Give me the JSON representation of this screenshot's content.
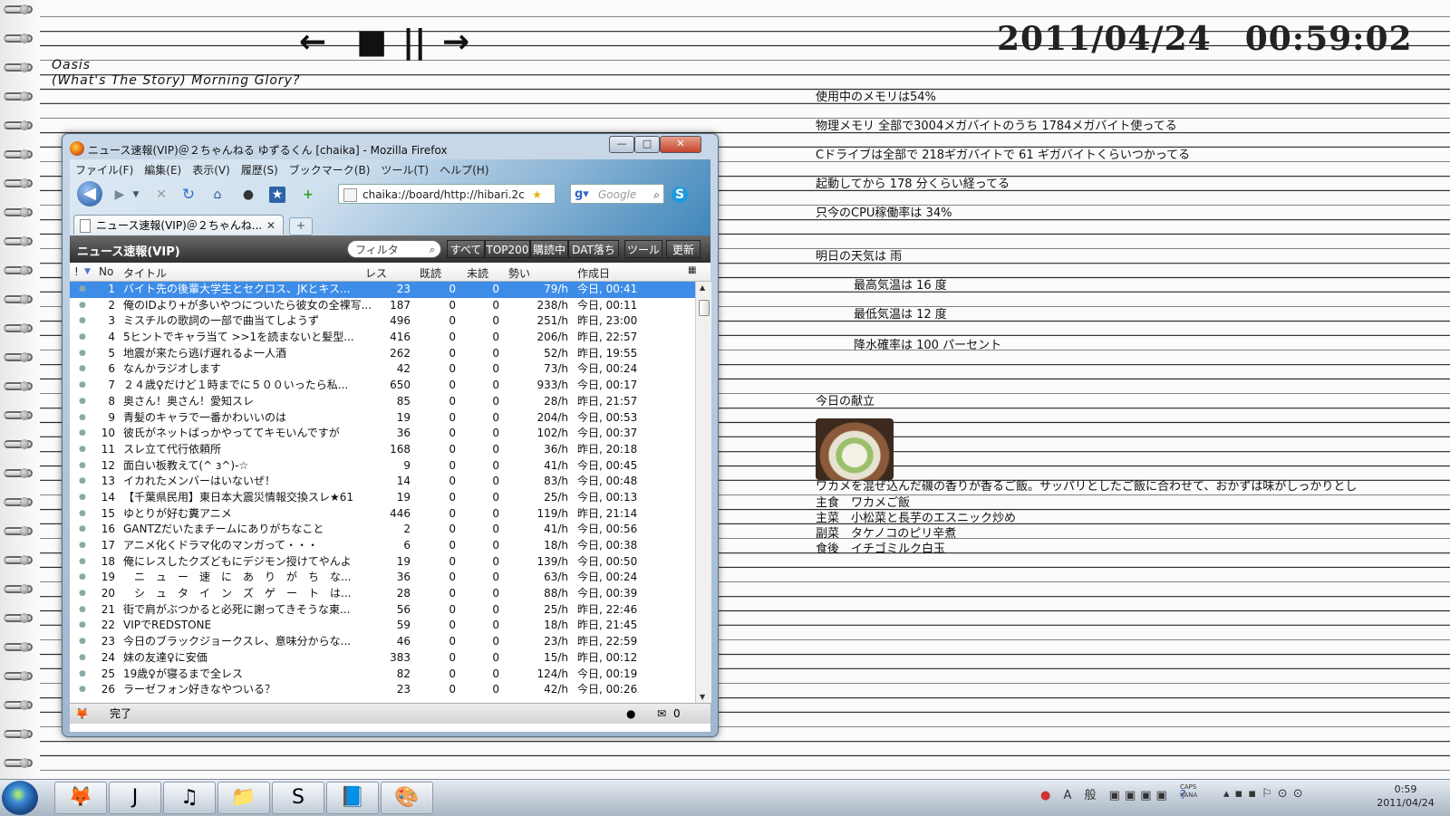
{
  "desktop": {
    "clock": "2011/04/24　00:59:02",
    "media_controls": {
      "prev": "←",
      "stop": "■",
      "pause": "||",
      "next": "→"
    },
    "now_playing": {
      "artist": "Oasis",
      "album": "(What's The Story) Morning Glory?"
    },
    "notes": [
      {
        "text": "使用中のメモリは54%"
      },
      {
        "text": "物理メモリ 全部で3004メガバイトのうち 1784メガバイト使ってる"
      },
      {
        "text": "Cドライブは全部で 218ギガバイトで 61 ギガバイトくらいつかってる"
      },
      {
        "text": "起動してから 178 分くらい経ってる"
      },
      {
        "text": "只今のCPU稼働率は 34%"
      },
      {
        "text": "明日の天気は 雨"
      },
      {
        "text": "最高気温は 16 度"
      },
      {
        "text": "最低気温は 12 度"
      },
      {
        "text": "降水確率は 100 パーセント"
      },
      {
        "text": "今日の献立"
      }
    ],
    "menu_description": "ワカメを混ぜ込んだ磯の香りが香るご飯。サッパリとしたご飯に合わせて、おかずは味がしっかりとし",
    "menu_items": [
      {
        "course": "主食",
        "dish": "ワカメご飯"
      },
      {
        "course": "主菜",
        "dish": "小松菜と長芋のエスニック炒め"
      },
      {
        "course": "副菜",
        "dish": "タケノコのピリ辛煮"
      },
      {
        "course": "食後",
        "dish": "イチゴミルク白玉"
      }
    ]
  },
  "window": {
    "title": "ニュース速報(VIP)＠２ちゃんねる ゆずるくん [chaika] - Mozilla Firefox",
    "buttons": {
      "minimize": "—",
      "maximize": "□",
      "close": "✕"
    },
    "menu": [
      "ファイル(F)",
      "編集(E)",
      "表示(V)",
      "履歴(S)",
      "ブックマーク(B)",
      "ツール(T)",
      "ヘルプ(H)"
    ],
    "url": "chaika://board/http://hibari.2c",
    "search_placeholder": "Google",
    "tab_label": "ニュース速報(VIP)＠２ちゃんね...",
    "board_name": "ニュース速報(VIP)",
    "filter_placeholder": "フィルタ",
    "board_buttons": [
      "すべて",
      "TOP200",
      "購読中",
      "DAT落ち",
      "ツール",
      "更新"
    ],
    "columns": {
      "flag": "!",
      "no": "No",
      "title": "タイトル",
      "res": "レス",
      "read": "既読",
      "unread": "未読",
      "momentum": "勢い",
      "date": "作成日"
    },
    "threads": [
      {
        "no": "1",
        "title": "バイト先の後輩大学生とセクロス、JKとキス...",
        "res": "23",
        "read": "0",
        "unread": "0",
        "momentum": "79/h",
        "date": "今日, 00:41"
      },
      {
        "no": "2",
        "title": "俺のIDより+が多いやつについたら彼女の全裸写...",
        "res": "187",
        "read": "0",
        "unread": "0",
        "momentum": "238/h",
        "date": "今日, 00:11"
      },
      {
        "no": "3",
        "title": "ミスチルの歌詞の一部で曲当てしようず",
        "res": "496",
        "read": "0",
        "unread": "0",
        "momentum": "251/h",
        "date": "昨日, 23:00"
      },
      {
        "no": "4",
        "title": "5ヒントでキャラ当て >>1を読まないと髪型...",
        "res": "416",
        "read": "0",
        "unread": "0",
        "momentum": "206/h",
        "date": "昨日, 22:57"
      },
      {
        "no": "5",
        "title": "地震が来たら逃げ遅れるよ一人酒",
        "res": "262",
        "read": "0",
        "unread": "0",
        "momentum": "52/h",
        "date": "昨日, 19:55"
      },
      {
        "no": "6",
        "title": "なんかラジオします",
        "res": "42",
        "read": "0",
        "unread": "0",
        "momentum": "73/h",
        "date": "今日, 00:24"
      },
      {
        "no": "7",
        "title": "２４歳♀だけど１時までに５００いったら私...",
        "res": "650",
        "read": "0",
        "unread": "0",
        "momentum": "933/h",
        "date": "今日, 00:17"
      },
      {
        "no": "8",
        "title": "奥さん！奥さん！愛知スレ",
        "res": "85",
        "read": "0",
        "unread": "0",
        "momentum": "28/h",
        "date": "昨日, 21:57"
      },
      {
        "no": "9",
        "title": "青髪のキャラで一番かわいいのは",
        "res": "19",
        "read": "0",
        "unread": "0",
        "momentum": "204/h",
        "date": "今日, 00:53"
      },
      {
        "no": "10",
        "title": "彼氏がネットばっかやっててキモいんですが",
        "res": "36",
        "read": "0",
        "unread": "0",
        "momentum": "102/h",
        "date": "今日, 00:37"
      },
      {
        "no": "11",
        "title": "スレ立て代行依頼所",
        "res": "168",
        "read": "0",
        "unread": "0",
        "momentum": "36/h",
        "date": "昨日, 20:18"
      },
      {
        "no": "12",
        "title": "面白い板教えて(^ з^)-☆",
        "res": "9",
        "read": "0",
        "unread": "0",
        "momentum": "41/h",
        "date": "今日, 00:45"
      },
      {
        "no": "13",
        "title": "イカれたメンバーはいないぜ！",
        "res": "14",
        "read": "0",
        "unread": "0",
        "momentum": "83/h",
        "date": "今日, 00:48"
      },
      {
        "no": "14",
        "title": "【千葉県民用】東日本大震災情報交換スレ★61",
        "res": "19",
        "read": "0",
        "unread": "0",
        "momentum": "25/h",
        "date": "今日, 00:13"
      },
      {
        "no": "15",
        "title": "ゆとりが好む糞アニメ",
        "res": "446",
        "read": "0",
        "unread": "0",
        "momentum": "119/h",
        "date": "昨日, 21:14"
      },
      {
        "no": "16",
        "title": "GANTZだいたまチームにありがちなこと",
        "res": "2",
        "read": "0",
        "unread": "0",
        "momentum": "41/h",
        "date": "今日, 00:56"
      },
      {
        "no": "17",
        "title": "アニメ化くドラマ化のマンガって・・・",
        "res": "6",
        "read": "0",
        "unread": "0",
        "momentum": "18/h",
        "date": "今日, 00:38"
      },
      {
        "no": "18",
        "title": "俺にレスしたクズどもにデジモン授けてやんよ",
        "res": "19",
        "read": "0",
        "unread": "0",
        "momentum": "139/h",
        "date": "今日, 00:50"
      },
      {
        "no": "19",
        "title": "　ニ　ュ　ー　速　に　あ　り　が　ち　な...",
        "res": "36",
        "read": "0",
        "unread": "0",
        "momentum": "63/h",
        "date": "今日, 00:24"
      },
      {
        "no": "20",
        "title": "　シ　ュ　タ　イ　ン　ズ　ゲ　ー　ト　は...",
        "res": "28",
        "read": "0",
        "unread": "0",
        "momentum": "88/h",
        "date": "今日, 00:39"
      },
      {
        "no": "21",
        "title": "街で肩がぶつかると必死に謝ってきそうな東...",
        "res": "56",
        "read": "0",
        "unread": "0",
        "momentum": "25/h",
        "date": "昨日, 22:46"
      },
      {
        "no": "22",
        "title": "VIPでREDSTONE",
        "res": "59",
        "read": "0",
        "unread": "0",
        "momentum": "18/h",
        "date": "昨日, 21:45"
      },
      {
        "no": "23",
        "title": "今日のブラックジョークスレ、意味分からな...",
        "res": "46",
        "read": "0",
        "unread": "0",
        "momentum": "23/h",
        "date": "昨日, 22:59"
      },
      {
        "no": "24",
        "title": "妹の友達♀に安価",
        "res": "383",
        "read": "0",
        "unread": "0",
        "momentum": "15/h",
        "date": "昨日, 00:12"
      },
      {
        "no": "25",
        "title": "19歳♀が寝るまで全レス",
        "res": "82",
        "read": "0",
        "unread": "0",
        "momentum": "124/h",
        "date": "今日, 00:19"
      },
      {
        "no": "26",
        "title": "ラーゼフォン好きなやついる？",
        "res": "23",
        "read": "0",
        "unread": "0",
        "momentum": "42/h",
        "date": "今日, 00:26"
      }
    ],
    "status_text": "完了",
    "mail_count": "0"
  },
  "taskbar": {
    "apps": [
      {
        "icon": "firefox-icon",
        "glyph": "🦊"
      },
      {
        "icon": "jane-icon",
        "glyph": "J"
      },
      {
        "icon": "itunes-icon",
        "glyph": "♫"
      },
      {
        "icon": "folder-icon",
        "glyph": "📁"
      },
      {
        "icon": "skype-icon",
        "glyph": "S"
      },
      {
        "icon": "notepad-icon",
        "glyph": "📘"
      },
      {
        "icon": "paint-icon",
        "glyph": "🎨"
      }
    ],
    "tray_text": "A 般",
    "caps": "CAPS",
    "kana": "KANA",
    "time": "0:59",
    "date": "2011/04/24"
  }
}
